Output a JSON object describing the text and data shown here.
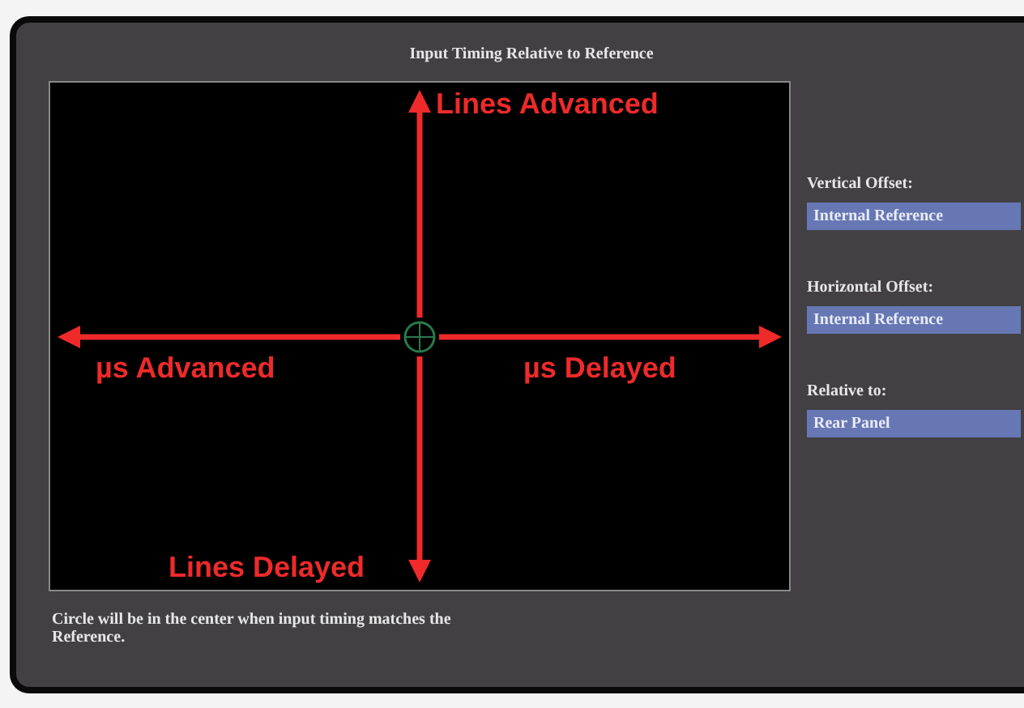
{
  "window": {
    "title": "Input Timing Relative to Reference"
  },
  "plot": {
    "label_up": "Lines Advanced",
    "label_left": "µs Advanced",
    "label_right": "µs Delayed",
    "label_down": "Lines Delayed"
  },
  "settings": [
    {
      "label": "Vertical Offset:",
      "value": "Internal Reference"
    },
    {
      "label": "Horizontal Offset:",
      "value": "Internal Reference"
    },
    {
      "label": "Relative to:",
      "value": "Rear Panel"
    }
  ],
  "note": "Circle will be in the center when input timing matches the Reference."
}
